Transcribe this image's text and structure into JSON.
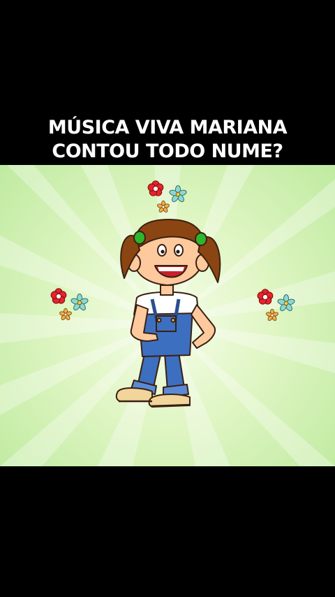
{
  "caption": {
    "line1": "MÚSICA VIVA MARIANA",
    "line2": "CONTOU TODO NUME?"
  },
  "colors": {
    "background": "#000000",
    "caption_text": "#ffffff",
    "scene_center": "#f6fdea",
    "scene_edge": "#bfeaa0",
    "hair": "#8b4513",
    "hair_tie": "#2db52d",
    "skin": "#ffc99e",
    "overalls": "#3d6fc0",
    "shirt": "#ffffff",
    "flower_red": "#e8232b",
    "flower_blue": "#8ed8d0",
    "flower_orange": "#f2b048"
  },
  "scene": {
    "illustration": "cartoon-girl-mariana",
    "decorations": [
      "flower-cluster-top",
      "flower-cluster-left",
      "flower-cluster-right"
    ]
  }
}
